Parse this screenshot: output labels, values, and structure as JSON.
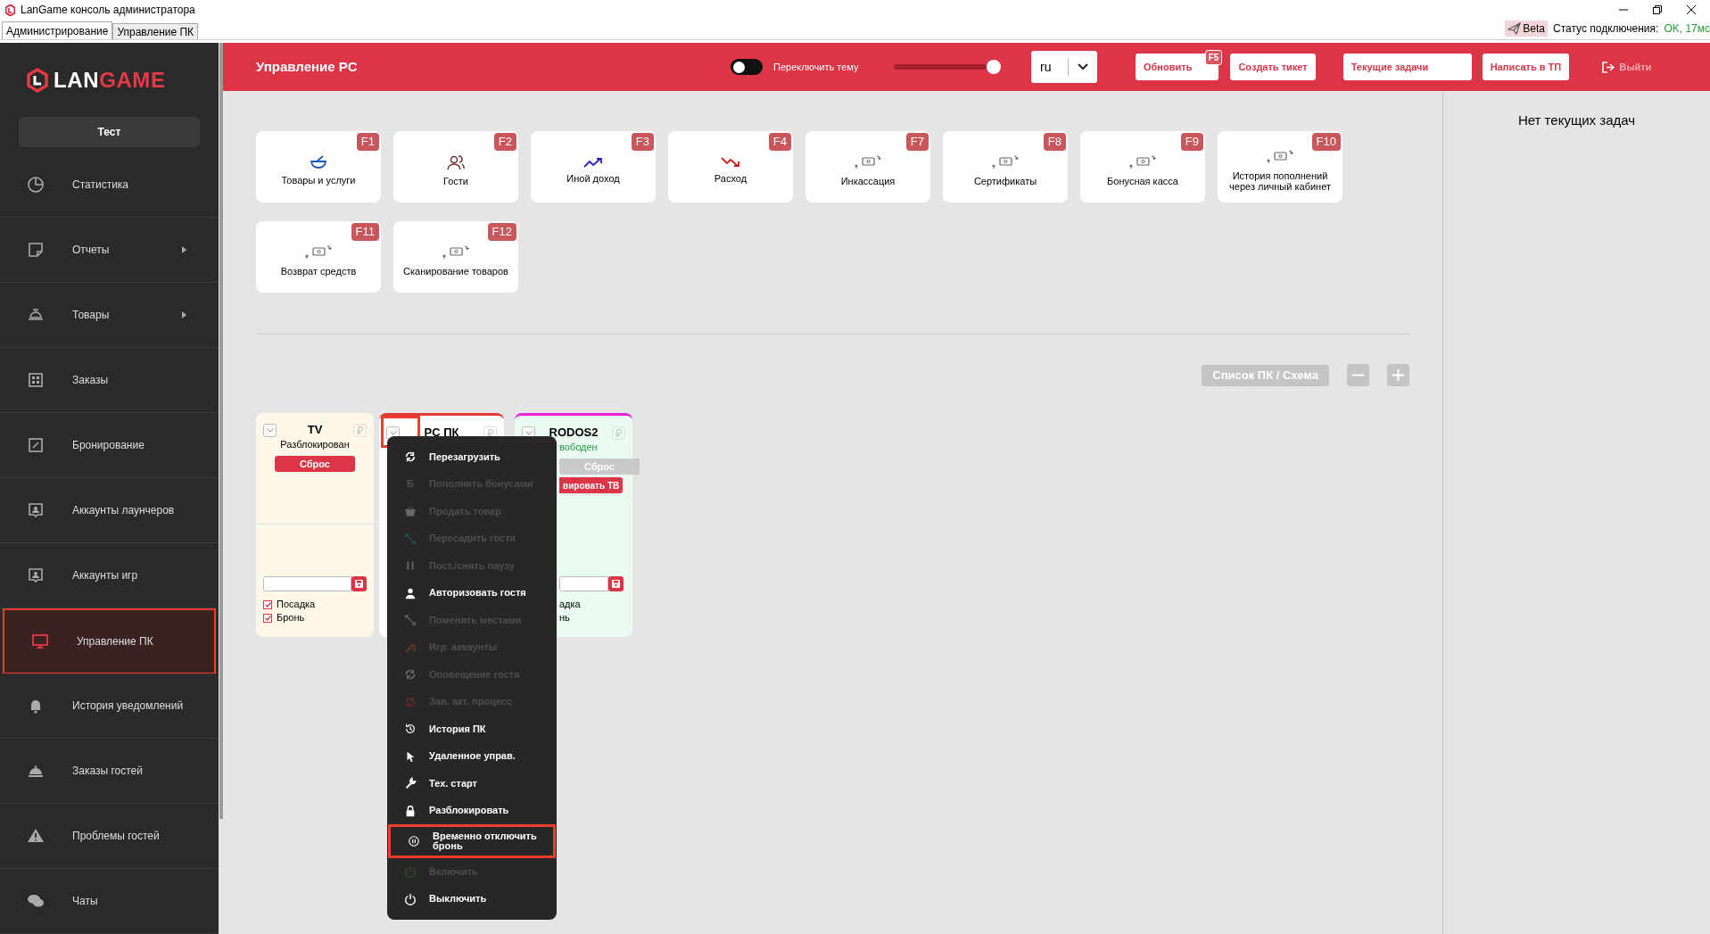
{
  "window": {
    "title": "LanGame консоль администратора"
  },
  "app_tabs": [
    {
      "label": "Администрирование",
      "selected": true
    },
    {
      "label": "Управление ПК",
      "selected": false
    }
  ],
  "connection": {
    "badge": "Beta",
    "label": "Статус подключения:",
    "value": "OK, 17мс"
  },
  "logo": {
    "part_1": "LAN",
    "part_2": "GAME"
  },
  "sidebar": {
    "user_button": "Тест",
    "items": [
      {
        "label": "Статистика",
        "has_submenu": false,
        "selected": false
      },
      {
        "label": "Отчеты",
        "has_submenu": true,
        "selected": false
      },
      {
        "label": "Товары",
        "has_submenu": true,
        "selected": false
      },
      {
        "label": "Заказы",
        "has_submenu": false,
        "selected": false
      },
      {
        "label": "Бронирование",
        "has_submenu": false,
        "selected": false
      },
      {
        "label": "Аккаунты лаунчеров",
        "has_submenu": false,
        "selected": false
      },
      {
        "label": "Аккаунты игр",
        "has_submenu": false,
        "selected": false
      },
      {
        "label": "Управление ПК",
        "has_submenu": false,
        "selected": true
      },
      {
        "label": "История уведомлений",
        "has_submenu": false,
        "selected": false
      },
      {
        "label": "Заказы гостей",
        "has_submenu": false,
        "selected": false
      },
      {
        "label": "Проблемы гостей",
        "has_submenu": false,
        "selected": false
      },
      {
        "label": "Чаты",
        "has_submenu": false,
        "selected": false
      }
    ]
  },
  "header": {
    "title": "Управление PC",
    "theme_toggle": {
      "label": "Переключить тему",
      "on": false
    },
    "slider": {
      "level": 1
    },
    "language": "ru",
    "buttons": [
      {
        "label": "Обновить",
        "hotkey": "F5"
      },
      {
        "label": "Создать тикет"
      },
      {
        "label": "Текущие задачи"
      },
      {
        "label": "Написать в ТП"
      }
    ],
    "logout": "Выйти"
  },
  "quick_actions": [
    {
      "label": "Товары и услуги",
      "hotkey": "F1"
    },
    {
      "label": "Гости",
      "hotkey": "F2"
    },
    {
      "label": "Иной доход",
      "hotkey": "F3"
    },
    {
      "label": "Расход",
      "hotkey": "F4"
    },
    {
      "label": "Инкассация",
      "hotkey": "F7"
    },
    {
      "label": "Сертификаты",
      "hotkey": "F8"
    },
    {
      "label": "Бонусная касса",
      "hotkey": "F9"
    },
    {
      "label": "История пополнений через личный кабинет",
      "hotkey": "F10"
    },
    {
      "label": "Возврат средств",
      "hotkey": "F11"
    },
    {
      "label": "Сканирование товаров",
      "hotkey": "F12"
    }
  ],
  "view_toggle": "Список ПК / Схема",
  "pcs": [
    {
      "name": "TV",
      "status": "Разблокирован",
      "kind": "unlocked",
      "reset": {
        "label": "Сброс",
        "disabled": false
      },
      "checkboxes": [
        {
          "label": "Посадка",
          "checked": true
        },
        {
          "label": "Бронь",
          "checked": true
        }
      ],
      "menu_open": false
    },
    {
      "name": "PC ПК",
      "color": "#e53935",
      "menu_open": true
    },
    {
      "name": "RODOS2",
      "color": "#e91ee0",
      "status": "вободен",
      "kind": "free",
      "reset": {
        "label": "Сброс",
        "disabled": true
      },
      "tv_button": "вировать ТВ",
      "checkboxes": [
        {
          "label": "адка"
        },
        {
          "label": "нь"
        }
      ],
      "menu_open": false
    }
  ],
  "context_menu": [
    {
      "label": "Перезагрузить",
      "disabled": false,
      "highlighted": false
    },
    {
      "glyph": "Б",
      "label": "Пополнить бонусами",
      "disabled": true,
      "highlighted": false
    },
    {
      "label": "Продать товар",
      "disabled": true,
      "highlighted": false
    },
    {
      "label": "Пересадить гостя",
      "disabled": true,
      "highlighted": false
    },
    {
      "label": "Пост./снять паузу",
      "disabled": true,
      "highlighted": false
    },
    {
      "label": "Авторизовать гостя",
      "disabled": false,
      "highlighted": false
    },
    {
      "label": "Поменять местами",
      "disabled": true,
      "highlighted": false
    },
    {
      "label": "Игр. аккаунты",
      "disabled": true,
      "highlighted": false
    },
    {
      "label": "Оповещение гостя",
      "disabled": true,
      "highlighted": false
    },
    {
      "label": "Зав. акт. процесс",
      "disabled": true,
      "highlighted": false
    },
    {
      "label": "История ПК",
      "disabled": false,
      "highlighted": false
    },
    {
      "label": "Удаленное управ.",
      "disabled": false,
      "highlighted": false
    },
    {
      "label": "Тех. старт",
      "disabled": false,
      "highlighted": false
    },
    {
      "label": "Разблокировать",
      "disabled": false,
      "highlighted": false
    },
    {
      "label": "Временно отключить бронь",
      "disabled": false,
      "highlighted": true
    },
    {
      "label": "Включить",
      "disabled": true,
      "highlighted": false
    },
    {
      "label": "Выключить",
      "disabled": false,
      "highlighted": false
    }
  ],
  "tasks_panel": {
    "empty_text": "Нет текущих задач"
  }
}
